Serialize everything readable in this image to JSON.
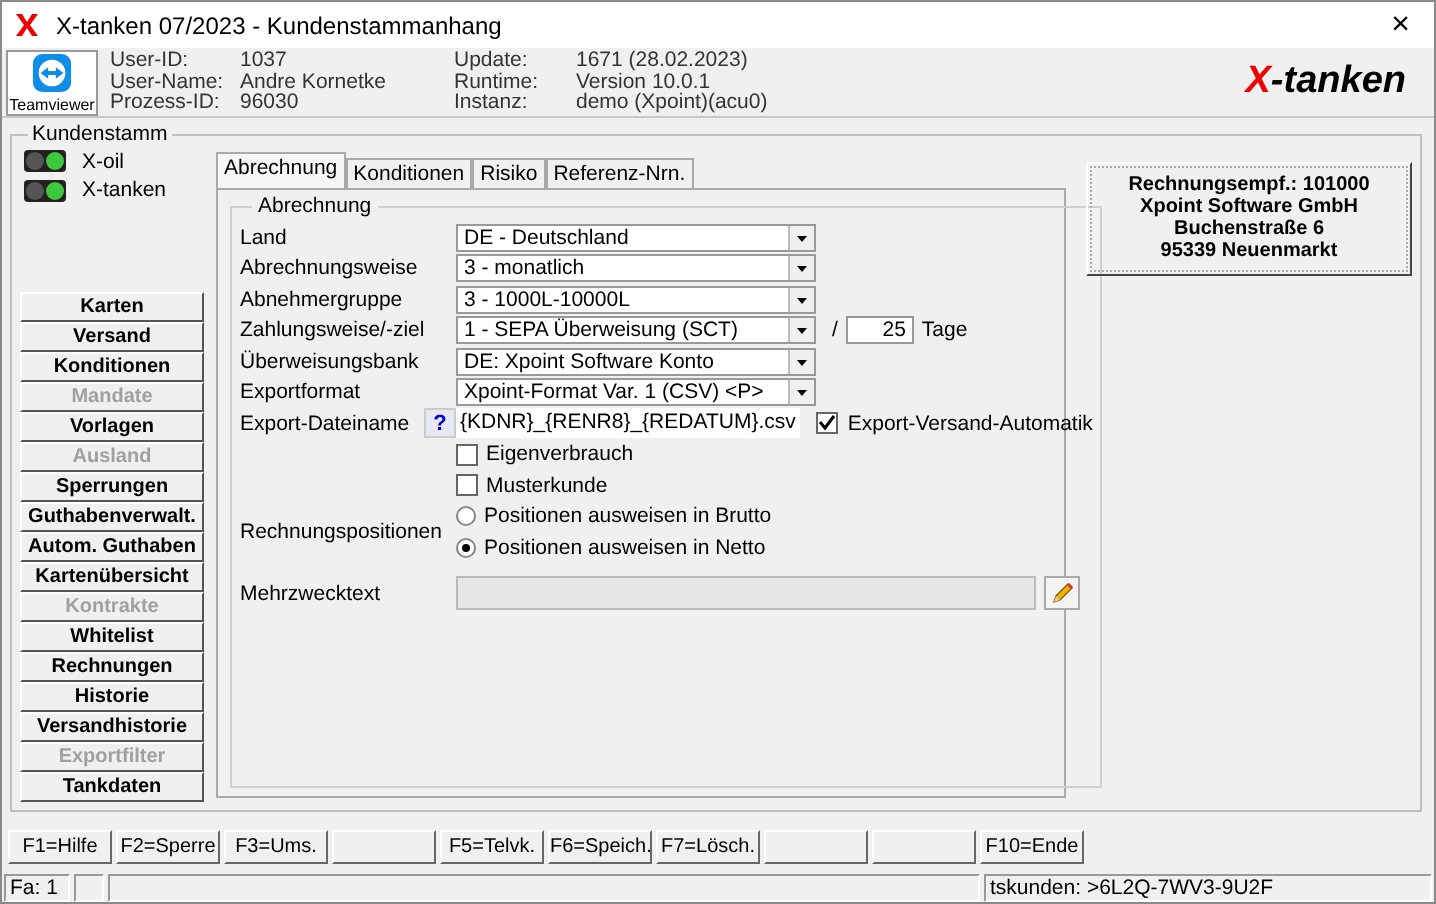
{
  "window": {
    "title": "X-tanken 07/2023 - Kundenstammanhang",
    "close": "×"
  },
  "header": {
    "teamviewer": "Teamviewer",
    "info": [
      {
        "label": "User-ID:",
        "value": "1037"
      },
      {
        "label": "User-Name:",
        "value": "Andre Kornetke"
      },
      {
        "label": "Prozess-ID:",
        "value": "96030"
      },
      {
        "label": "Update:",
        "value": "1671 (28.02.2023)"
      },
      {
        "label": "Runtime:",
        "value": "Version 10.0.1"
      },
      {
        "label": "Instanz:",
        "value": "demo (Xpoint)(acu0)"
      }
    ],
    "logo": {
      "mark": "X",
      "rest": "-tanken"
    }
  },
  "group_title": "Kundenstamm",
  "systems": [
    {
      "label": "X-oil",
      "on": true
    },
    {
      "label": "X-tanken",
      "on": true
    }
  ],
  "side_buttons": [
    {
      "label": "Karten",
      "disabled": false
    },
    {
      "label": "Versand",
      "disabled": false
    },
    {
      "label": "Konditionen",
      "disabled": false
    },
    {
      "label": "Mandate",
      "disabled": true
    },
    {
      "label": "Vorlagen",
      "disabled": false
    },
    {
      "label": "Ausland",
      "disabled": true
    },
    {
      "label": "Sperrungen",
      "disabled": false
    },
    {
      "label": "Guthabenverwalt.",
      "disabled": false
    },
    {
      "label": "Autom. Guthaben",
      "disabled": false
    },
    {
      "label": "Kartenübersicht",
      "disabled": false
    },
    {
      "label": "Kontrakte",
      "disabled": true
    },
    {
      "label": "Whitelist",
      "disabled": false
    },
    {
      "label": "Rechnungen",
      "disabled": false
    },
    {
      "label": "Historie",
      "disabled": false
    },
    {
      "label": "Versandhistorie",
      "disabled": false
    },
    {
      "label": "Exportfilter",
      "disabled": true
    },
    {
      "label": "Tankdaten",
      "disabled": false
    }
  ],
  "tabs": [
    {
      "label": "Abrechnung",
      "selected": true
    },
    {
      "label": "Konditionen",
      "selected": false
    },
    {
      "label": "Risiko",
      "selected": false
    },
    {
      "label": "Referenz-Nrn.",
      "selected": false
    }
  ],
  "form": {
    "title": "Abrechnung",
    "rows": [
      {
        "kind": "select",
        "label": "Land",
        "value": "DE - Deutschland"
      },
      {
        "kind": "select",
        "label": "Abrechnungsweise",
        "value": "3 - monatlich"
      },
      {
        "kind": "select",
        "label": "Abnehmergruppe",
        "value": "3 - 1000L-10000L"
      },
      {
        "kind": "select_days",
        "label": "Zahlungsweise/-ziel",
        "value": "1 - SEPA Überweisung (SCT)",
        "separator": "/",
        "days": "25",
        "unit": "Tage"
      },
      {
        "kind": "select",
        "label": "Überweisungsbank",
        "value": "DE: Xpoint Software Konto"
      },
      {
        "kind": "select",
        "label": "Exportformat",
        "value": "Xpoint-Format Var. 1 (CSV) <P>"
      },
      {
        "kind": "filename",
        "label": "Export-Dateiname",
        "help": "?",
        "value": "{KDNR}_{RENR8}_{REDATUM}.csv",
        "option": {
          "label": "Export-Versand-Automatik",
          "checked": true
        }
      },
      {
        "kind": "checkbox",
        "label": "Eigenverbrauch",
        "checked": false
      },
      {
        "kind": "checkbox",
        "label": "Musterkunde",
        "checked": false
      },
      {
        "kind": "radio",
        "label": "Rechnungspositionen",
        "options": [
          {
            "label": "Positionen ausweisen in Brutto",
            "selected": false
          },
          {
            "label": "Positionen ausweisen in Netto",
            "selected": true
          }
        ]
      },
      {
        "kind": "text",
        "label": "Mehrzwecktext"
      }
    ]
  },
  "recipient": [
    "Rechnungsempf.: 101000",
    "Xpoint Software GmbH",
    "Buchenstraße 6",
    "95339 Neuenmarkt"
  ],
  "function_keys": [
    {
      "kind": "key",
      "label": "F1=Hilfe"
    },
    {
      "kind": "key",
      "label": "F2=Sperre"
    },
    {
      "kind": "key",
      "label": "F3=Ums."
    },
    {
      "kind": "blank"
    },
    {
      "kind": "key",
      "label": "F5=Telvk."
    },
    {
      "kind": "key",
      "label": "F6=Speich."
    },
    {
      "kind": "key",
      "label": "F7=Lösch."
    },
    {
      "kind": "blank"
    },
    {
      "kind": "blank"
    },
    {
      "kind": "key",
      "label": "F10=Ende"
    }
  ],
  "status_bar": {
    "left": "Fa: 1",
    "right": "tskunden: >6L2Q-7WV3-9U2F"
  }
}
